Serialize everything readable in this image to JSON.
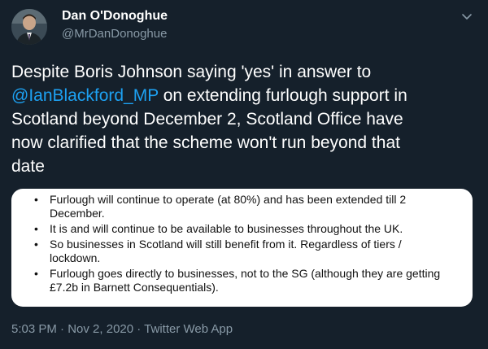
{
  "author": {
    "display_name": "Dan O'Donoghue",
    "handle": "@MrDanDonoghue",
    "avatar_icon": "user-avatar-photo"
  },
  "menu": {
    "icon": "chevron-down-icon"
  },
  "tweet": {
    "line1": "Despite Boris Johnson saying 'yes' in answer to",
    "mention": "@IanBlackford_MP",
    "line2_rest": " on extending furlough support in",
    "line3": "Scotland beyond December 2, Scotland Office have",
    "line4": "now clarified that the scheme won't run beyond that",
    "line5": "date"
  },
  "attachment": {
    "bullet": "•",
    "items": [
      {
        "line1": "Furlough will continue to operate (at 80%) and has been extended till 2",
        "line2": "December."
      },
      {
        "line1": "It is and will continue to be available to businesses throughout the UK."
      },
      {
        "line1": "So businesses in Scotland will still benefit from it. Regardless of tiers /",
        "line2": "lockdown."
      },
      {
        "line1": "Furlough goes directly to businesses, not to the SG (although they are getting",
        "line2": "£7.2b in Barnett Consequentials)."
      }
    ]
  },
  "meta": {
    "time": "5:03 PM",
    "separator1": " · ",
    "date": "Nov 2, 2020",
    "separator2": " · ",
    "source": "Twitter Web App"
  },
  "colors": {
    "background": "#15202b",
    "text": "#ffffff",
    "secondary_text": "#8899a6",
    "link": "#1da1f2",
    "attachment_bg": "#ffffff"
  }
}
